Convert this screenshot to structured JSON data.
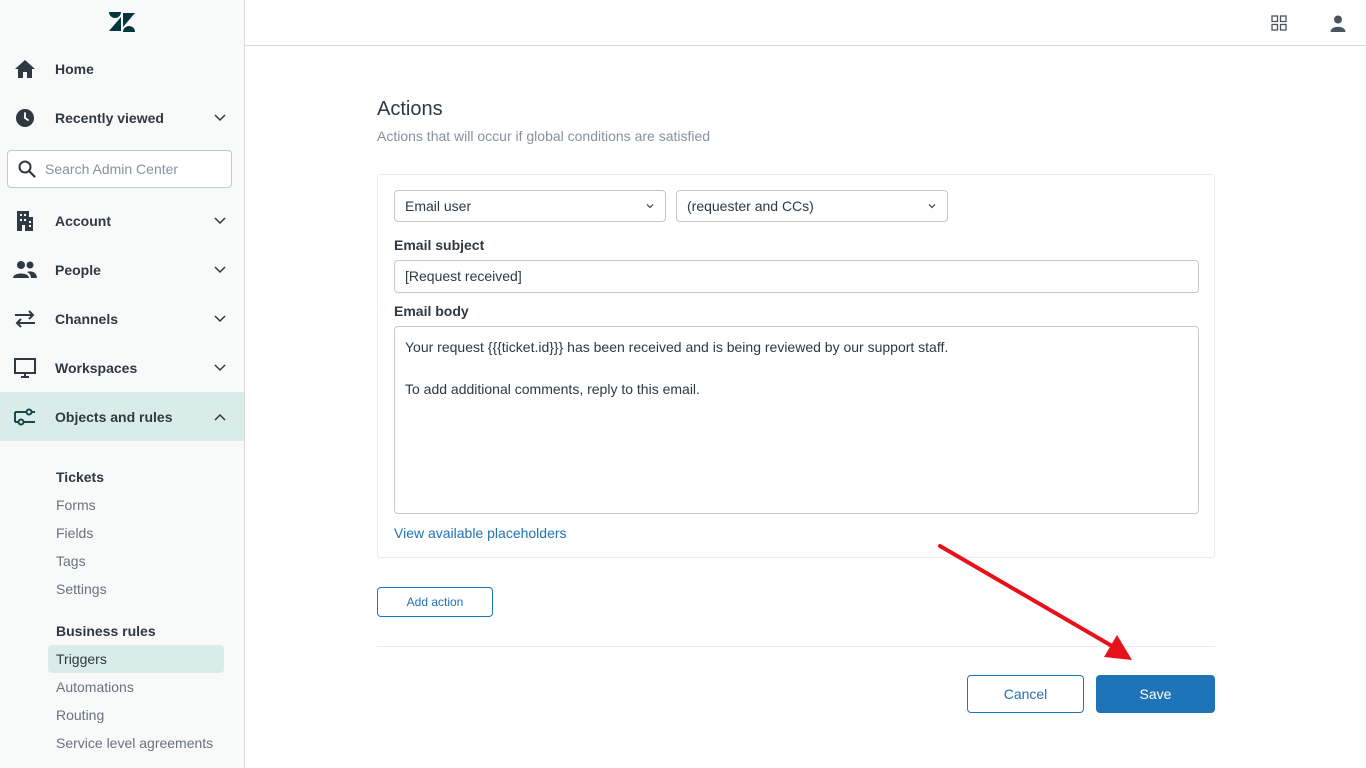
{
  "sidebar": {
    "logo_icon": "zendesk-logo",
    "search": {
      "placeholder": "Search Admin Center"
    },
    "items": [
      {
        "label": "Home",
        "icon": "home-icon"
      },
      {
        "label": "Recently viewed",
        "icon": "clock-icon"
      },
      {
        "label": "Account",
        "icon": "building-icon"
      },
      {
        "label": "People",
        "icon": "people-icon"
      },
      {
        "label": "Channels",
        "icon": "arrows-icon"
      },
      {
        "label": "Workspaces",
        "icon": "monitor-icon"
      },
      {
        "label": "Objects and rules",
        "icon": "objects-rules-icon"
      }
    ],
    "tickets": {
      "heading": "Tickets",
      "links": [
        "Forms",
        "Fields",
        "Tags",
        "Settings"
      ]
    },
    "business_rules": {
      "heading": "Business rules",
      "links": [
        "Triggers",
        "Automations",
        "Routing",
        "Service level agreements"
      ],
      "selected": "Triggers"
    }
  },
  "topbar": {
    "icons": [
      "grid-icon",
      "user-icon"
    ]
  },
  "actions": {
    "title": "Actions",
    "subtitle": "Actions that will occur if global conditions are satisfied",
    "action_select": "Email user",
    "target_select": "(requester and CCs)",
    "email_subject_label": "Email subject",
    "email_subject_value": "[Request received]",
    "email_body_label": "Email body",
    "email_body_line1": "Your request {{{ticket.id}}} has been received and is being reviewed by our support staff.",
    "email_body_line2": "",
    "email_body_line3": "To add additional comments, reply to this email.",
    "placeholders_link": "View available placeholders",
    "add_action": "Add action"
  },
  "footer": {
    "cancel": "Cancel",
    "save": "Save"
  },
  "colors": {
    "accent": "#1f73b7",
    "active_nav": "#d9ecea",
    "annotation_arrow": "#e8101a"
  }
}
